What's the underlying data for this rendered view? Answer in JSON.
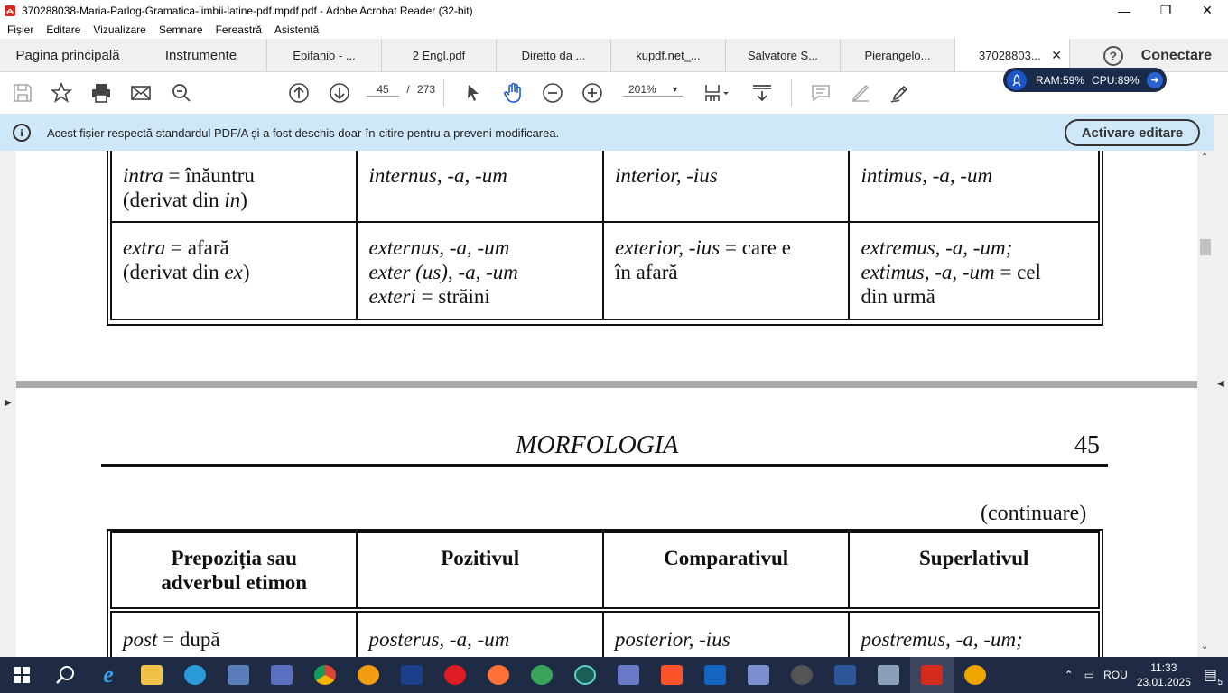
{
  "window": {
    "title": "370288038-Maria-Parlog-Gramatica-limbii-latine-pdf.mpdf.pdf - Adobe Acrobat Reader (32-bit)",
    "minimize": "—",
    "maximize": "❐",
    "close": "✕"
  },
  "menu": [
    "Fișier",
    "Editare",
    "Vizualizare",
    "Semnare",
    "Fereastră",
    "Asistență"
  ],
  "tabs": {
    "home": "Pagina principală",
    "tools": "Instrumente",
    "docs": [
      "Epifanio - ...",
      "2 Engl.pdf",
      "Diretto da ...",
      "kupdf.net_...",
      "Salvatore S...",
      "Pierangelo..."
    ],
    "active": "37028803...",
    "active_close": "✕",
    "help": "?",
    "connect": "Conectare"
  },
  "toolbar": {
    "page_current": "45",
    "page_sep": "/",
    "page_total": "273",
    "zoom": "201%"
  },
  "perf": {
    "ram": "RAM:59%",
    "cpu": "CPU:89%"
  },
  "infobar": {
    "icon": "i",
    "message": "Acest fișier respectă standardul PDF/A și a fost deschis doar-în-citire pentru a preveni modificarea.",
    "button": "Activare editare"
  },
  "page44": {
    "rows": [
      {
        "c1_it": "intra",
        "c1_rest": " = înăuntru",
        "c1_l2a": "(derivat din ",
        "c1_l2it": "in",
        "c1_l2b": ")",
        "c2": "internus, -a, -um",
        "c3": "interior, -ius",
        "c4": "intimus, -a, -um"
      },
      {
        "c1_it": "extra",
        "c1_rest": " = afară",
        "c1_l2a": "(derivat din ",
        "c1_l2it": "ex",
        "c1_l2b": ")",
        "c2_l1": "externus, -a, -um",
        "c2_l2": "exter (us), -a, -um",
        "c2_l3it": "exteri",
        "c2_l3": " = străini",
        "c3_it": "exterior, -ius",
        "c3_rest": " = care e",
        "c3_l2": "în afară",
        "c4_l1": "extremus, -a, -um;",
        "c4_l2it": "extimus, -a, -um",
        "c4_l2": " = cel",
        "c4_l3": "din urmă"
      }
    ]
  },
  "page45": {
    "header_title": "MORFOLOGIA",
    "page_number": "45",
    "continuation": "(continuare)",
    "columns": [
      "Prepoziția sau adverbul etimon",
      "Pozitivul",
      "Comparativul",
      "Superlativul"
    ],
    "col1_l1": "Prepoziția sau",
    "col1_l2": "adverbul etimon",
    "row": {
      "c1_it": "post",
      "c1_rest": " = după",
      "c2": "posterus, -a, -um",
      "c3": "posterior, -ius",
      "c4": "postremus, -a, -um;"
    }
  },
  "taskbar": {
    "lang": "ROU",
    "time": "11:33",
    "date": "23.01.2025",
    "notifications": "5"
  }
}
